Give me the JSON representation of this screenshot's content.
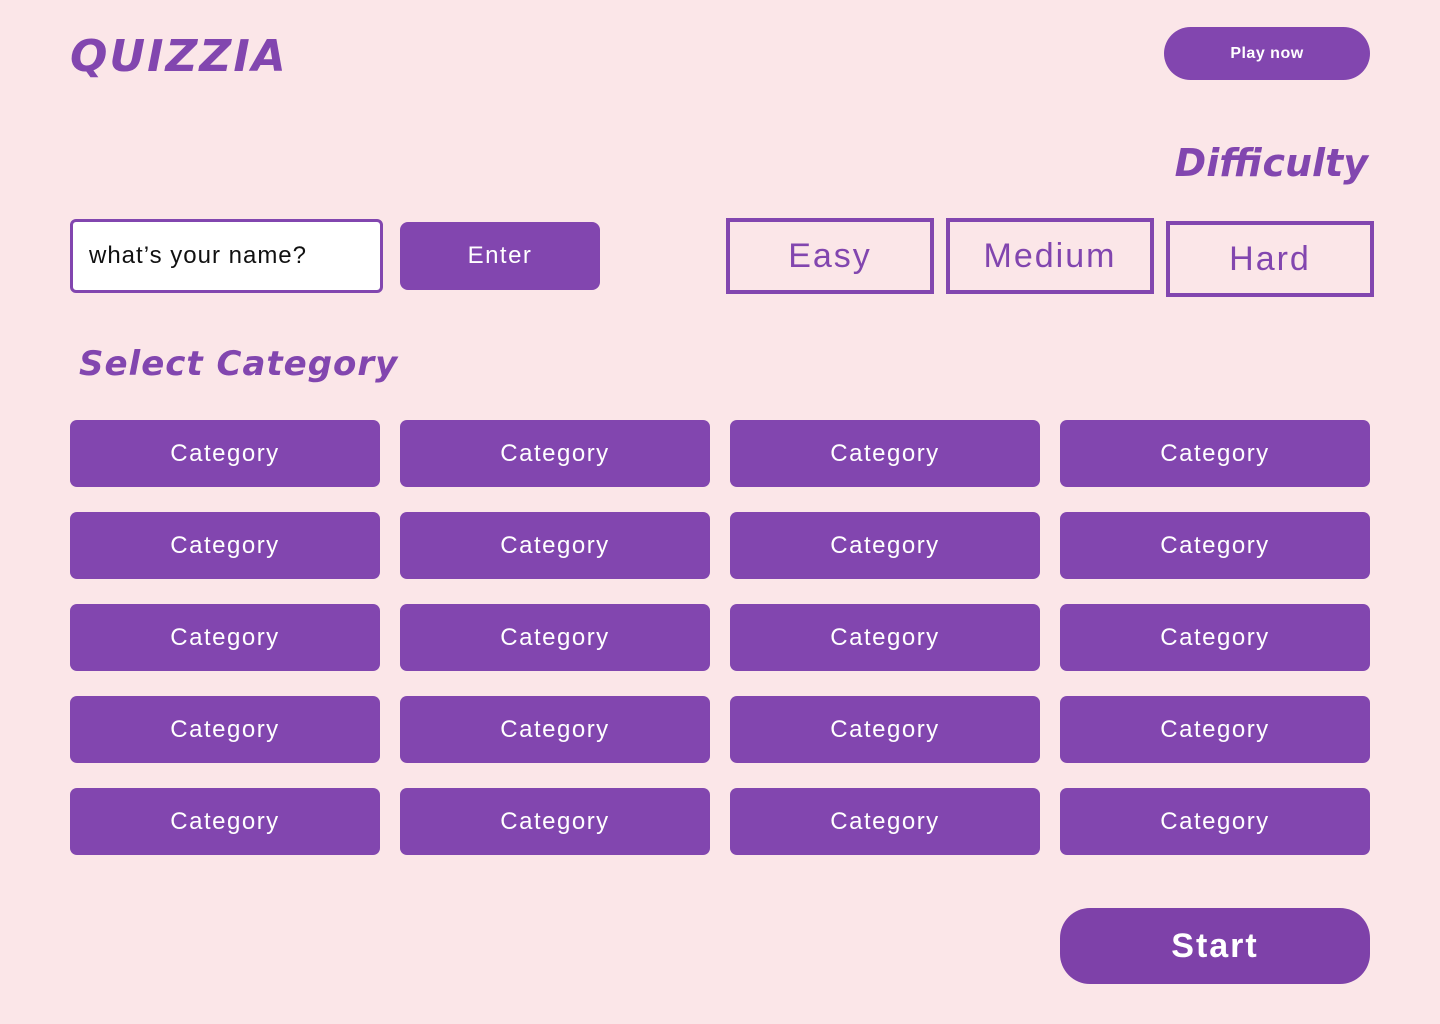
{
  "header": {
    "logo": "QUIZZIA",
    "play_now_label": "Play now"
  },
  "name_form": {
    "placeholder": "what’s your name?",
    "value": "",
    "enter_label": "Enter"
  },
  "difficulty": {
    "title": "Difficulty",
    "options": [
      "Easy",
      "Medium",
      "Hard"
    ]
  },
  "categories": {
    "title": "Select Category",
    "items": [
      "Category",
      "Category",
      "Category",
      "Category",
      "Category",
      "Category",
      "Category",
      "Category",
      "Category",
      "Category",
      "Category",
      "Category",
      "Category",
      "Category",
      "Category",
      "Category",
      "Category",
      "Category",
      "Category",
      "Category"
    ]
  },
  "footer": {
    "start_label": "Start"
  },
  "colors": {
    "background": "#FBE6E8",
    "accent": "#8246AF",
    "button_text": "#FFFFFF"
  }
}
